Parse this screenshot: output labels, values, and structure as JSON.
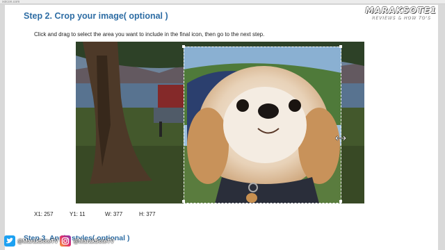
{
  "browser": {
    "url": "xoicon.com"
  },
  "step2": {
    "title": "Step 2. Crop your image( optional )",
    "instruction": "Click and drag to select the area you want to include in the final icon, then go to the next step."
  },
  "coords": {
    "x1": "X1: 257",
    "y1": "Y1: 11",
    "w": "W: 377",
    "h": "H: 377"
  },
  "step3": {
    "title": "Step 3. Apply styles( optional )"
  },
  "watermark": {
    "line1": "MARAKSOTE1",
    "line2": "REVIEWS & HOW TO'S"
  },
  "social": {
    "twitter_handle": "@MarakSoteTV",
    "instagram_handle": "@MarakSoteTV",
    "twitter_icon": "twitter-icon",
    "instagram_icon": "instagram-icon"
  },
  "colors": {
    "heading": "#2e6da4",
    "twitter": "#1da1f2"
  }
}
